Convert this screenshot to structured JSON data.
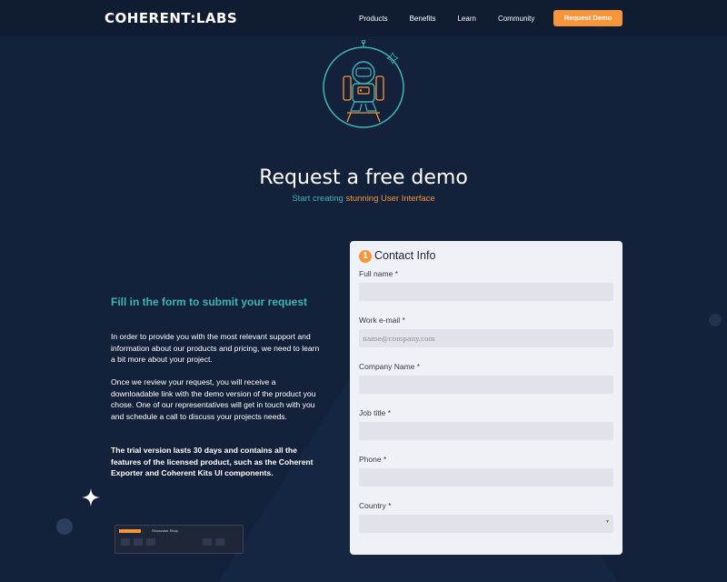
{
  "nav": {
    "logo": "COHERENT:LABS",
    "links": [
      "Products",
      "Benefits",
      "Learn",
      "Community"
    ],
    "cta": "Request Demo"
  },
  "hero": {
    "title": "Request a free demo",
    "subtitle_a": "Start creating",
    "subtitle_b": "stunning User Interface"
  },
  "left": {
    "heading": "Fill in the form to submit your request",
    "paragraphs": [
      "In order to provide you with the most relevant support and information about our products and pricing, we need to learn a bit more about your project.",
      "Once we review your request, you will receive a downloadable link with the demo version of the product you chose. One of our representatives will get in touch with you and schedule a call to discuss your projects needs.",
      "The trial version lasts 30 days and contains all the features of the licensed product, such as the Coherent Exporter and Coherent Kits UI components."
    ],
    "thumbnail_title": "Showcase Shop"
  },
  "form": {
    "step": "1",
    "title": "Contact Info",
    "fields": [
      {
        "label": "Full name *",
        "placeholder": ""
      },
      {
        "label": "Work e-mail *",
        "placeholder": "name@company.com"
      },
      {
        "label": "Company Name *",
        "placeholder": ""
      },
      {
        "label": "Job title *",
        "placeholder": ""
      },
      {
        "label": "Phone *",
        "placeholder": ""
      },
      {
        "label": "Country *",
        "placeholder": ""
      }
    ]
  },
  "colors": {
    "background": "#13213a",
    "accent_orange": "#f7953b",
    "accent_teal": "#3fb5b6",
    "card": "#eef2f6"
  },
  "icons": [
    "astronaut-illustration",
    "sparkle-icon",
    "chevron-down-icon"
  ]
}
